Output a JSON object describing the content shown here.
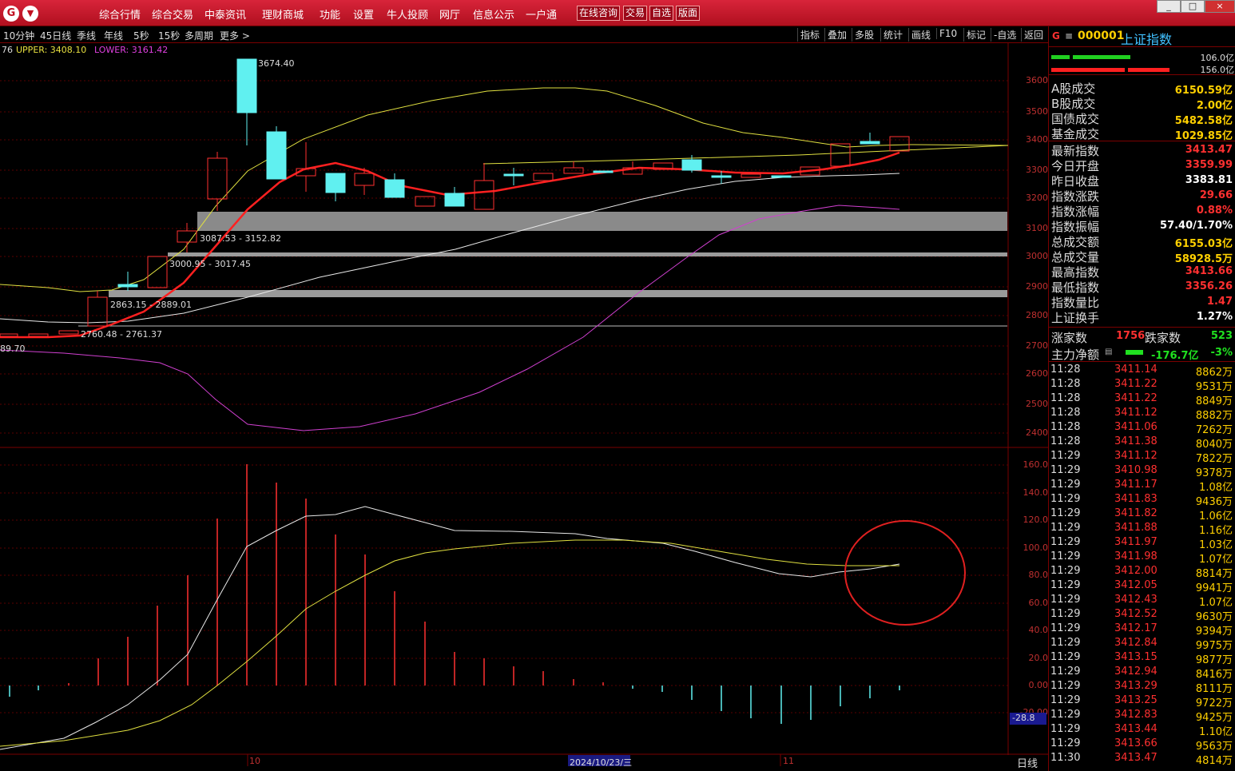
{
  "menu": {
    "logo": "G",
    "items": [
      "综合行情",
      "综合交易",
      "中泰资讯",
      "理财商城",
      "功能",
      "设置",
      "牛人投顾",
      "网厅",
      "信息公示",
      "一户通"
    ],
    "buttons": [
      "在线咨询",
      "交易",
      "自选",
      "版面"
    ],
    "window_controls": [
      "_",
      "□",
      "×"
    ]
  },
  "toolbar": {
    "periods": [
      "10分钟",
      "45日线",
      "季线",
      "年线",
      "5秒",
      "15秒",
      "多周期",
      "更多 >"
    ],
    "tools": [
      "指标",
      "叠加",
      "多股",
      "统计",
      "画线",
      "F10",
      "标记",
      "-自选",
      "返回"
    ]
  },
  "boll": {
    "prefix": "76",
    "upper_label": "UPPER: 3408.10",
    "lower_label": "LOWER: 3161.42"
  },
  "chart_data": {
    "type": "candlestick",
    "y_axis": [
      3600,
      3500,
      3400,
      3300,
      3200,
      3100,
      3000,
      2900,
      2800,
      2700,
      2600,
      2500,
      2400
    ],
    "gap_zones": [
      "3087.53 - 3152.82",
      "3000.95 - 3017.45",
      "2863.15 - 2889.01",
      "2760.48 - 2761.37"
    ],
    "peak_label": "3674.40",
    "left_value": "89.70",
    "indicator_axis": [
      "160.0",
      "140.0",
      "120.0",
      "100.0",
      "80.0",
      "60.0",
      "40.0",
      "20.0",
      "0.00",
      "-20.00"
    ],
    "indicator_current": "-28.8",
    "x_labels": [
      "10",
      "2024/10/23/三",
      "11"
    ],
    "period_label": "日线"
  },
  "quote": {
    "flag": "G",
    "code": "000001",
    "name": "上证指数",
    "bar_top": "106.0亿",
    "bar_bottom": "156.0亿",
    "rows": [
      {
        "label": "A股成交",
        "value": "6150.59亿",
        "color": "#ffd000"
      },
      {
        "label": "B股成交",
        "value": "2.00亿",
        "color": "#ffd000"
      },
      {
        "label": "国债成交",
        "value": "5482.58亿",
        "color": "#ffd000"
      },
      {
        "label": "基金成交",
        "value": "1029.85亿",
        "color": "#ffd000"
      },
      {
        "label": "最新指数",
        "value": "3413.47",
        "color": "#ff3030"
      },
      {
        "label": "今日开盘",
        "value": "3359.99",
        "color": "#ff3030"
      },
      {
        "label": "昨日收盘",
        "value": "3383.81",
        "color": "#ffffff"
      },
      {
        "label": "指数涨跌",
        "value": "29.66",
        "color": "#ff3030"
      },
      {
        "label": "指数涨幅",
        "value": "0.88%",
        "color": "#ff3030"
      },
      {
        "label": "指数振幅",
        "value": "57.40/1.70%",
        "color": "#ffffff"
      },
      {
        "label": "总成交额",
        "value": "6155.03亿",
        "color": "#ffd000"
      },
      {
        "label": "总成交量",
        "value": "58928.5万",
        "color": "#ffd000"
      },
      {
        "label": "最高指数",
        "value": "3413.66",
        "color": "#ff3030"
      },
      {
        "label": "最低指数",
        "value": "3356.26",
        "color": "#ff3030"
      },
      {
        "label": "指数量比",
        "value": "1.47",
        "color": "#ff3030"
      },
      {
        "label": "上证换手",
        "value": "1.27%",
        "color": "#ffffff"
      }
    ],
    "up_label": "涨家数",
    "up_count": "1756",
    "down_label": "跌家数",
    "down_count": "523",
    "flow_label": "主力净额",
    "flow_value": "-176.7亿",
    "flow_pct": "-3%"
  },
  "ticks": [
    [
      "11:28",
      "3411.14",
      "8862万"
    ],
    [
      "11:28",
      "3411.22",
      "9531万"
    ],
    [
      "11:28",
      "3411.22",
      "8849万"
    ],
    [
      "11:28",
      "3411.12",
      "8882万"
    ],
    [
      "11:28",
      "3411.06",
      "7262万"
    ],
    [
      "11:28",
      "3411.38",
      "8040万"
    ],
    [
      "11:29",
      "3411.12",
      "7822万"
    ],
    [
      "11:29",
      "3410.98",
      "9378万"
    ],
    [
      "11:29",
      "3411.17",
      "1.08亿"
    ],
    [
      "11:29",
      "3411.83",
      "9436万"
    ],
    [
      "11:29",
      "3411.82",
      "1.06亿"
    ],
    [
      "11:29",
      "3411.88",
      "1.16亿"
    ],
    [
      "11:29",
      "3411.97",
      "1.03亿"
    ],
    [
      "11:29",
      "3411.98",
      "1.07亿"
    ],
    [
      "11:29",
      "3412.00",
      "8814万"
    ],
    [
      "11:29",
      "3412.05",
      "9941万"
    ],
    [
      "11:29",
      "3412.43",
      "1.07亿"
    ],
    [
      "11:29",
      "3412.52",
      "9630万"
    ],
    [
      "11:29",
      "3412.17",
      "9394万"
    ],
    [
      "11:29",
      "3412.84",
      "9975万"
    ],
    [
      "11:29",
      "3413.15",
      "9877万"
    ],
    [
      "11:29",
      "3412.94",
      "8416万"
    ],
    [
      "11:29",
      "3413.29",
      "8111万"
    ],
    [
      "11:29",
      "3413.25",
      "9722万"
    ],
    [
      "11:29",
      "3412.83",
      "9425万"
    ],
    [
      "11:29",
      "3413.44",
      "1.10亿"
    ],
    [
      "11:29",
      "3413.66",
      "9563万"
    ],
    [
      "11:30",
      "3413.47",
      "4814万"
    ]
  ]
}
